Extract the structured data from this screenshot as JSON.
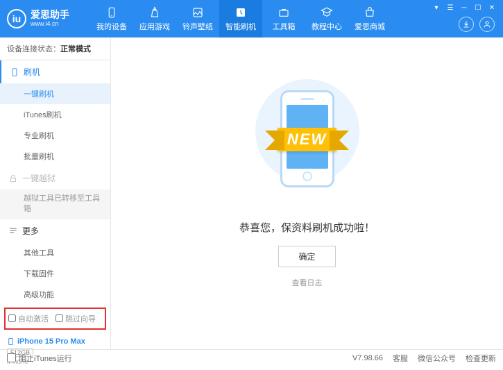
{
  "header": {
    "logo_glyph": "iu",
    "title": "爱思助手",
    "url": "www.i4.cn",
    "nav": [
      {
        "label": "我的设备"
      },
      {
        "label": "应用游戏"
      },
      {
        "label": "铃声壁纸"
      },
      {
        "label": "智能刷机"
      },
      {
        "label": "工具箱"
      },
      {
        "label": "教程中心"
      },
      {
        "label": "爱思商城"
      }
    ]
  },
  "sidebar": {
    "conn_label": "设备连接状态：",
    "conn_mode": "正常模式",
    "section_flash": "刷机",
    "items_flash": [
      "一键刷机",
      "iTunes刷机",
      "专业刷机",
      "批量刷机"
    ],
    "section_jail": "一键越狱",
    "jail_info": "越狱工具已转移至工具箱",
    "section_more": "更多",
    "items_more": [
      "其他工具",
      "下载固件",
      "高级功能"
    ],
    "chk_auto_activate": "自动激活",
    "chk_skip_guide": "跳过向导",
    "device_name": "iPhone 15 Pro Max",
    "device_storage": "512GB",
    "device_type": "iPhone"
  },
  "main": {
    "ribbon": "NEW",
    "success": "恭喜您，保资料刷机成功啦！",
    "ok": "确定",
    "view_log": "查看日志"
  },
  "footer": {
    "block_itunes": "阻止iTunes运行",
    "version": "V7.98.66",
    "links": [
      "客服",
      "微信公众号",
      "检查更新"
    ]
  }
}
